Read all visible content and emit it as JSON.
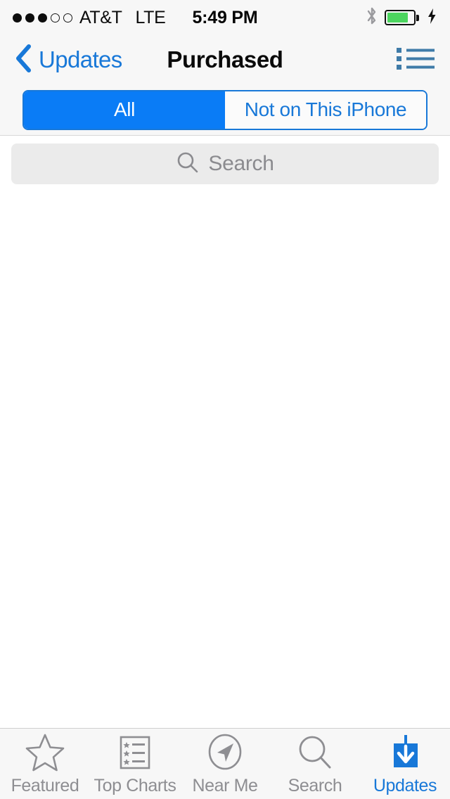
{
  "status_bar": {
    "signal_dots_filled": 3,
    "signal_dots_total": 5,
    "carrier": "AT&T",
    "network": "LTE",
    "time": "5:49 PM",
    "bluetooth_icon": "bluetooth-icon",
    "battery_level_percent": 80,
    "battery_charging": true,
    "battery_color": "#4cd55f"
  },
  "nav_bar": {
    "back_label": "Updates",
    "back_icon": "chevron-left-icon",
    "title": "Purchased",
    "right_icon": "bullet-list-icon",
    "accent_color": "#1878d8"
  },
  "segmented_control": {
    "selected_index": 0,
    "options": [
      {
        "label": "All"
      },
      {
        "label": "Not on This iPhone"
      }
    ],
    "selected_bg": "#0a7cf6",
    "border_color": "#1878d8"
  },
  "search": {
    "placeholder": "Search",
    "value": "",
    "icon": "search-icon"
  },
  "content": {
    "items": []
  },
  "tab_bar": {
    "selected_index": 4,
    "tabs": [
      {
        "label": "Featured",
        "icon": "star-icon"
      },
      {
        "label": "Top Charts",
        "icon": "top-charts-icon"
      },
      {
        "label": "Near Me",
        "icon": "compass-arrow-icon"
      },
      {
        "label": "Search",
        "icon": "search-icon"
      },
      {
        "label": "Updates",
        "icon": "download-arrow-icon"
      }
    ],
    "inactive_color": "#8e8e92",
    "active_color": "#1878d8"
  }
}
